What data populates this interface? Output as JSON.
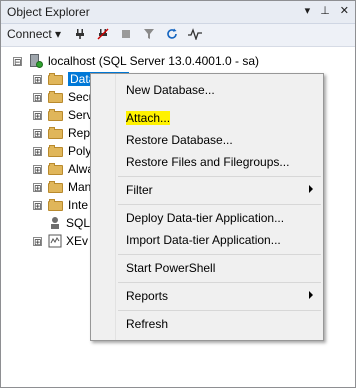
{
  "panel": {
    "title": "Object Explorer",
    "ctrl_dropdown": "▾",
    "ctrl_pin": "⊥",
    "ctrl_close": "✕"
  },
  "toolbar": {
    "connect_label": "Connect ▾"
  },
  "tree": {
    "root": {
      "expander": "⊟",
      "label": "localhost (SQL Server 13.0.4001.0 - sa)"
    },
    "items": [
      {
        "expander": "⊞",
        "label": "Databases"
      },
      {
        "expander": "⊞",
        "label": "Secu"
      },
      {
        "expander": "⊞",
        "label": "Serv"
      },
      {
        "expander": "⊞",
        "label": "Repl"
      },
      {
        "expander": "⊞",
        "label": "Poly"
      },
      {
        "expander": "⊞",
        "label": "Alwa"
      },
      {
        "expander": "⊞",
        "label": "Man"
      },
      {
        "expander": "⊞",
        "label": "Inte"
      },
      {
        "expander": "",
        "label": "SQL"
      },
      {
        "expander": "⊞",
        "label": "XEv"
      }
    ]
  },
  "context_menu": {
    "items": [
      {
        "label": "New Database..."
      },
      {
        "label": "Attach..."
      },
      {
        "label": "Restore Database..."
      },
      {
        "label": "Restore Files and Filegroups..."
      },
      {
        "label": "Filter"
      },
      {
        "label": "Deploy Data-tier Application..."
      },
      {
        "label": "Import Data-tier Application..."
      },
      {
        "label": "Start PowerShell"
      },
      {
        "label": "Reports"
      },
      {
        "label": "Refresh"
      }
    ],
    "highlight_color": "#fff200"
  }
}
